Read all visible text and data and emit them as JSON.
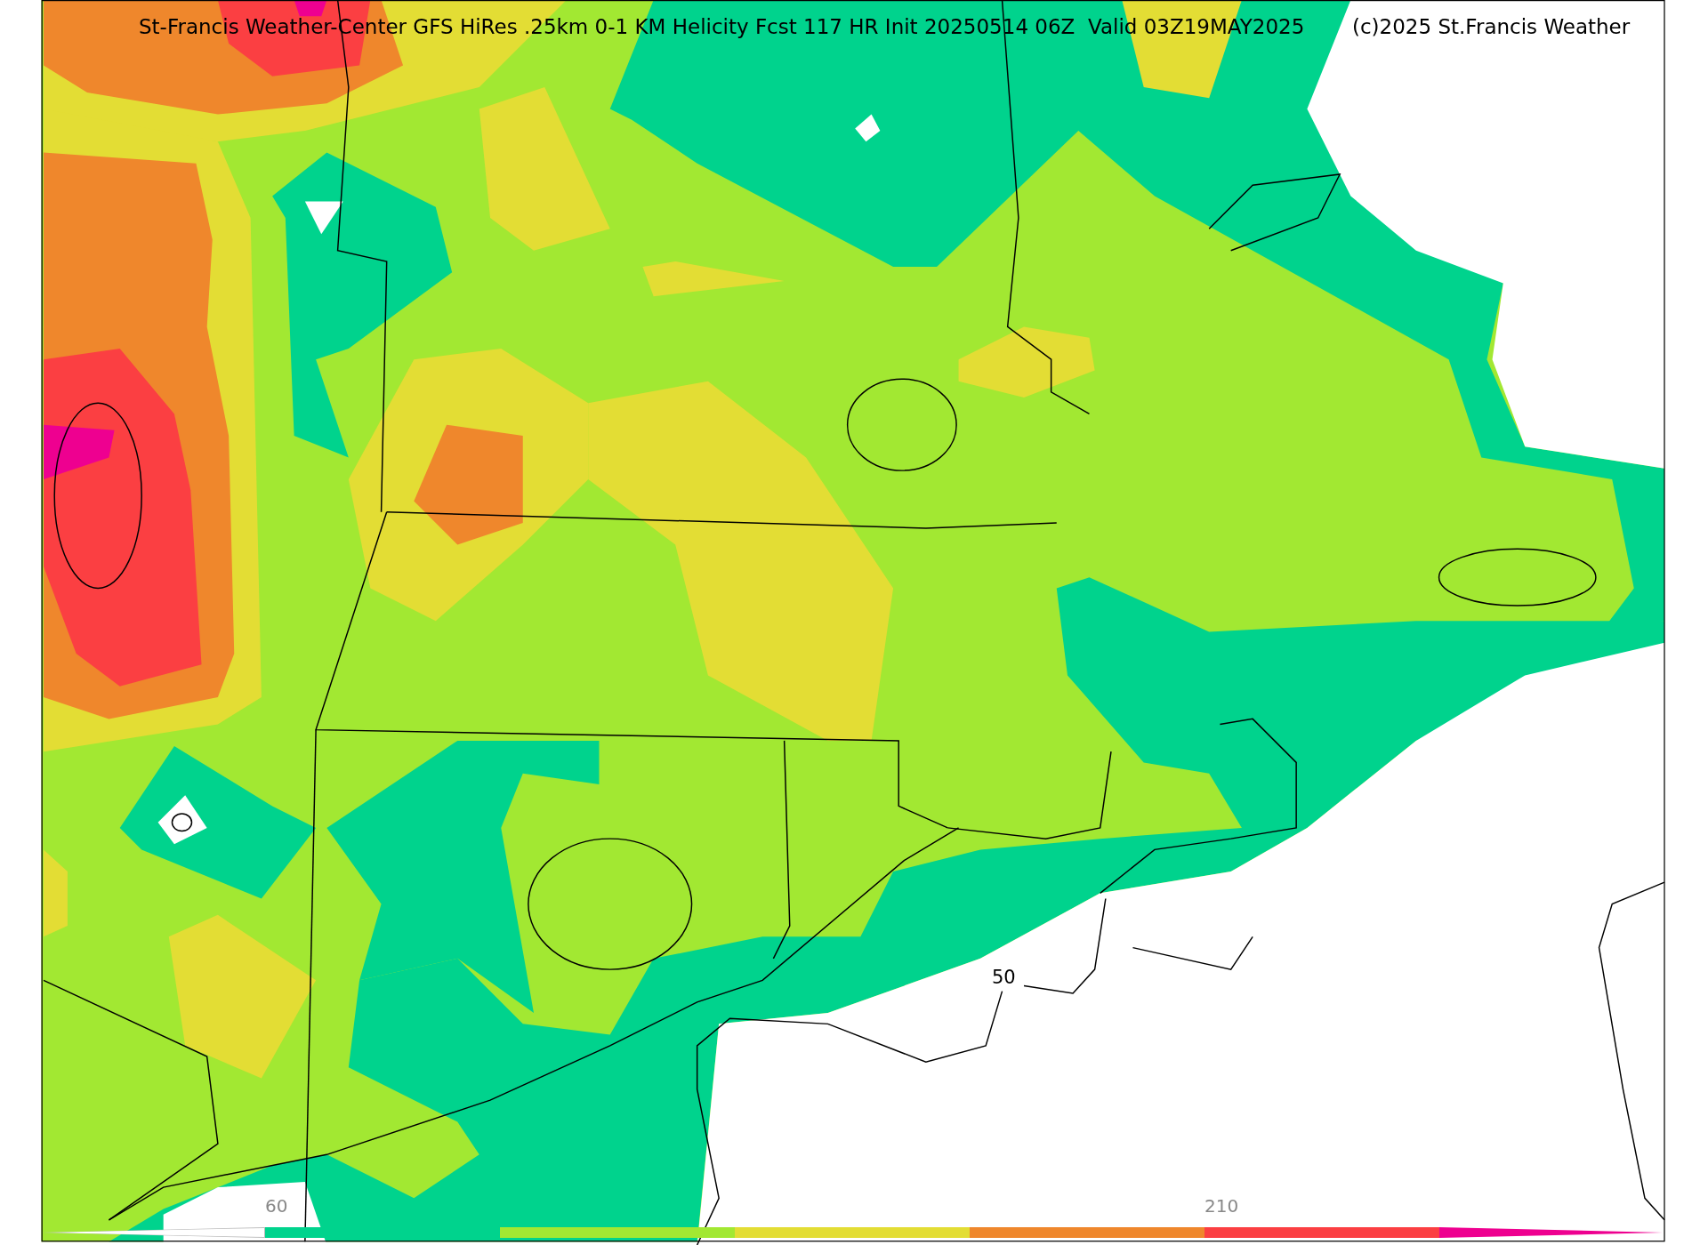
{
  "title": "St-Francis Weather-Center GFS HiRes .25km 0-1 KM Helicity Fcst 117 HR Init 20250514 06Z  Valid 03Z19MAY2025",
  "copyright": "(c)2025 St.Francis Weather",
  "contour_labels": [
    "50"
  ],
  "colorbar": {
    "bins": [
      {
        "kind": "under",
        "color": "#ffffff"
      },
      {
        "kind": "bin",
        "color": "#00d38d",
        "tick_label": "60"
      },
      {
        "kind": "bin",
        "color": "#a2e832"
      },
      {
        "kind": "bin",
        "color": "#e3dd34"
      },
      {
        "kind": "bin",
        "color": "#ef872c"
      },
      {
        "kind": "bin",
        "color": "#fb3f42",
        "tick_label": "210"
      },
      {
        "kind": "over",
        "color": "#ee0090"
      }
    ]
  }
}
